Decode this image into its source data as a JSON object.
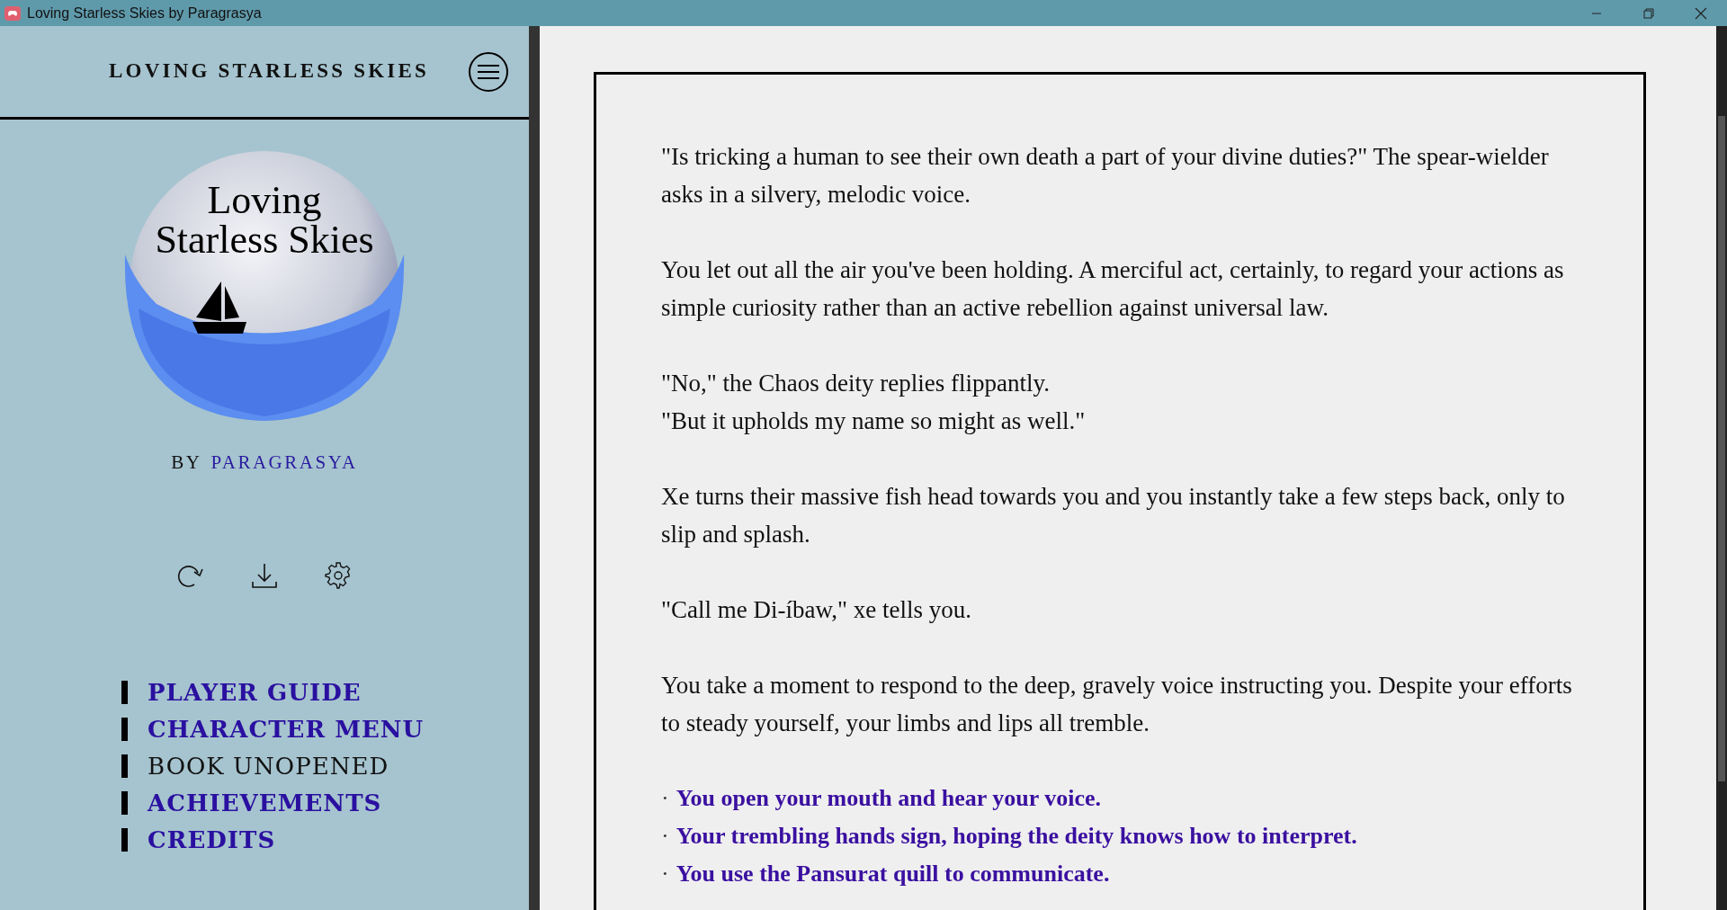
{
  "window": {
    "title": "Loving Starless Skies by Paragrasya"
  },
  "sidebar": {
    "header_title": "LOVING STARLESS SKIES",
    "cover": {
      "title_lines": [
        "Loving",
        "Starless Skies"
      ]
    },
    "byline": {
      "prefix": "BY",
      "author": "PARAGRASYA"
    },
    "nav": [
      {
        "label": "PLAYER GUIDE",
        "disabled": false
      },
      {
        "label": "CHARACTER MENU",
        "disabled": false
      },
      {
        "label": "BOOK UNOPENED",
        "disabled": true
      },
      {
        "label": "ACHIEVEMENTS",
        "disabled": false
      },
      {
        "label": "CREDITS",
        "disabled": false
      }
    ]
  },
  "passage": {
    "paragraphs": [
      [
        "\"Is tricking a human to see their own death a part of your divine duties?\" The spear-wielder asks in a silvery, melodic voice."
      ],
      [
        "You let out all the air you've been holding. A merciful act, certainly, to regard your actions as simple curiosity rather than an active rebellion against universal law."
      ],
      [
        "\"No,\" the Chaos deity replies flippantly.",
        "\"But it upholds my name so might as well.\""
      ],
      [
        "Xe turns their massive fish head towards you and you instantly take a few steps back, only to slip and splash."
      ],
      [
        "\"Call me Di-íbaw,\" xe tells you."
      ],
      [
        "You take a moment to respond to the deep, gravely voice instructing you. Despite your efforts to steady yourself, your limbs and lips all tremble."
      ]
    ],
    "choices": [
      {
        "marker": "·",
        "text": "You open your mouth and hear your voice."
      },
      {
        "marker": "·",
        "text": "Your trembling hands sign, hoping the deity knows how to interpret."
      },
      {
        "marker": "·",
        "text": "You use the Pansurat quill to communicate."
      }
    ]
  }
}
